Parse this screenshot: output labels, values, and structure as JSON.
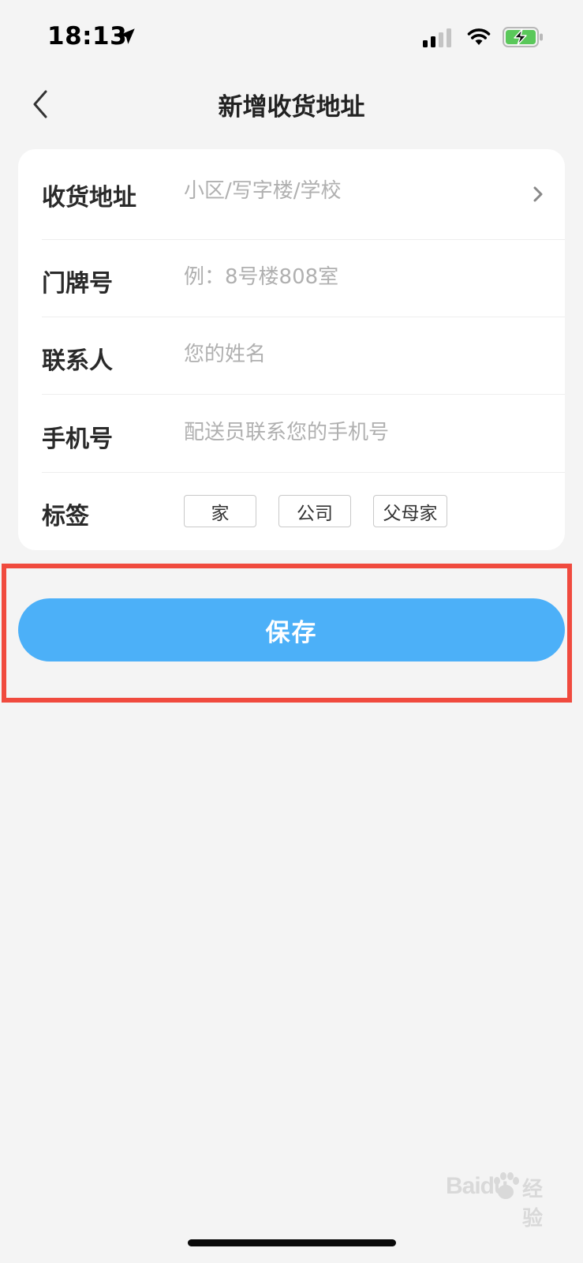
{
  "status_bar": {
    "time": "18:13",
    "icons": [
      "location-arrow-icon",
      "cellular-signal-icon",
      "wifi-icon",
      "battery-charging-icon"
    ],
    "battery_color": "#5ac85a"
  },
  "nav": {
    "title": "新增收货地址",
    "back_icon": "chevron-left-icon"
  },
  "form": {
    "rows": [
      {
        "label": "收货地址",
        "placeholder": "小区/写字楼/学校",
        "value": "",
        "trailing_icon": "chevron-right-icon"
      },
      {
        "label": "门牌号",
        "placeholder": "例：8号楼808室",
        "value": ""
      },
      {
        "label": "联系人",
        "placeholder": "您的姓名",
        "value": ""
      },
      {
        "label": "手机号",
        "placeholder": "配送员联系您的手机号",
        "value": ""
      }
    ],
    "tag_row": {
      "label": "标签",
      "tags": [
        "家",
        "公司",
        "父母家"
      ]
    }
  },
  "save_button": {
    "label": "保存",
    "color": "#4cb0f8"
  },
  "highlight": {
    "color": "#f04a3e"
  },
  "watermark": {
    "text_latin": "Baidu",
    "text_cn": "经验"
  }
}
